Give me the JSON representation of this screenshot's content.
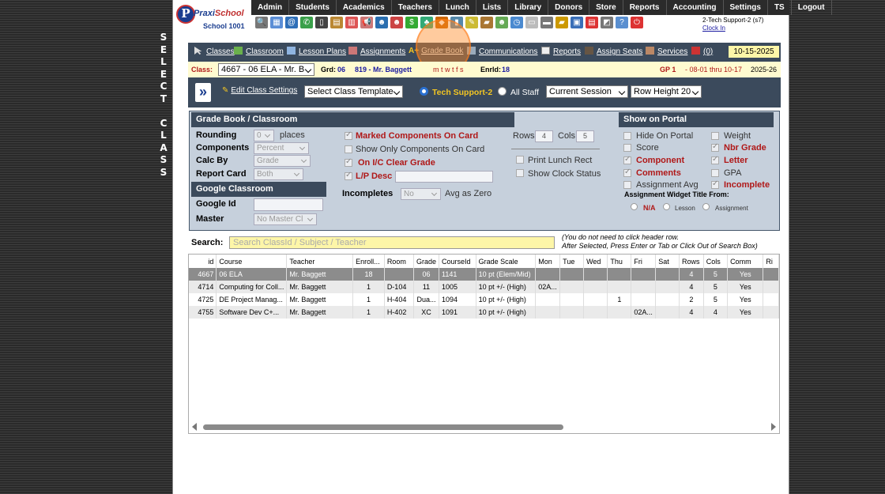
{
  "side_letters": [
    "S",
    "E",
    "L",
    "E",
    "C",
    "T",
    "",
    "C",
    "L",
    "A",
    "S",
    "S"
  ],
  "logo": {
    "letter": "P",
    "brand_a": "Praxi",
    "brand_b": "School",
    "school": "School 1001"
  },
  "menu": [
    "Admin",
    "Students",
    "Academics",
    "Teachers",
    "Lunch",
    "Lists",
    "Library",
    "Donors",
    "Store",
    "Reports",
    "Accounting",
    "Settings",
    "TS",
    "Logout"
  ],
  "toolbar_icons": [
    "search-icon",
    "grid-icon",
    "at-icon",
    "chat-icon",
    "phone-icon",
    "card-icon",
    "calendar-icon",
    "megaphone-icon",
    "person-icon",
    "person-icon",
    "money-icon",
    "group-icon",
    "lunch-icon",
    "book-icon",
    "pencil-icon",
    "cart-icon",
    "person-icon",
    "clock-icon",
    "card-icon",
    "id-icon",
    "bus-icon",
    "gradebook-icon",
    "pdf-icon",
    "chart-icon",
    "help-icon",
    "power-icon"
  ],
  "user": {
    "name": "2-Tech Support-2 (s7)",
    "clock_in": "Clock In"
  },
  "nav": {
    "classes": "Classes",
    "classroom": "Classroom",
    "lesson_plans": "Lesson Plans",
    "assignments": "Assignments",
    "grade_book": "Grade Book",
    "communications": "Communications",
    "reports": "Reports",
    "assign_seats": "Assign Seats",
    "services": "Services",
    "count": "(0)",
    "date": "10-15-2025"
  },
  "classbar": {
    "class_label": "Class:",
    "class_value": "4667 - 06 ELA - Mr. B",
    "grd_label": "Grd:",
    "grd": "06",
    "teacher": "819 - Mr. Baggett",
    "days": "m t w t f s",
    "enrld_label": "Enrld:",
    "enrld": "18",
    "gp": "GP 1",
    "gp_dates": "- 08-01 thru 10-17",
    "year": "2025-26"
  },
  "tools": {
    "edit_settings": "Edit Class Settings",
    "template": "Select Class Template",
    "staff_self": "Tech Support-2",
    "staff_all": "All Staff",
    "session": "Current Session",
    "row_height": "Row Height 20"
  },
  "settings": {
    "head": "Grade Book / Classroom",
    "rounding_label": "Rounding",
    "rounding": "0",
    "places": "places",
    "components_label": "Components",
    "components": "Percent",
    "calc_label": "Calc By",
    "calc": "Grade",
    "report_label": "Report Card",
    "report": "Both",
    "google_head": "Google Classroom",
    "google_id": "Google Id",
    "master": "Master",
    "master_value": "No Master Cl",
    "marked": "Marked Components On Card",
    "only": "Show Only Components On Card",
    "clear": "On I/C Clear Grade",
    "lp": "L/P Desc",
    "incompletes": "Incompletes",
    "incompletes_value": "No",
    "avg_zero": "Avg as Zero",
    "rows_label": "Rows",
    "rows": "4",
    "cols_label": "Cols",
    "cols": "5",
    "print_lunch": "Print Lunch Rect",
    "show_clock": "Show Clock Status",
    "portal_head": "Show on Portal",
    "hide": "Hide On Portal",
    "score": "Score",
    "component": "Component",
    "comments": "Comments",
    "assign_avg": "Assignment Avg",
    "weight": "Weight",
    "nbr": "Nbr Grade",
    "letter": "Letter",
    "gpa": "GPA",
    "incomplete": "Incomplete",
    "widget_title": "Assignment Widget Title From:",
    "na": "N/A",
    "lesson": "Lesson",
    "assignment": "Assignment"
  },
  "search": {
    "label": "Search:",
    "placeholder": "Search ClassId / Subject / Teacher",
    "note1": "(You do not need to click header row.",
    "note2": "After Selected, Press Enter or Tab or Click Out of Search Box)"
  },
  "table": {
    "headers": [
      "id",
      "Course",
      "Teacher",
      "Enroll...",
      "Room",
      "Grade",
      "CourseId",
      "Grade Scale",
      "Mon",
      "Tue",
      "Wed",
      "Thu",
      "Fri",
      "Sat",
      "Rows",
      "Cols",
      "Comm",
      "Ri"
    ],
    "rows": [
      [
        "4667",
        "06 ELA",
        "Mr. Baggett",
        "18",
        "",
        "06",
        "1141",
        "10 pt (Elem/Mid)",
        "",
        "",
        "",
        "",
        "",
        "",
        "4",
        "5",
        "Yes",
        ""
      ],
      [
        "4714",
        "Computing for Coll...",
        "Mr. Baggett",
        "1",
        "D-104",
        "11",
        "1005",
        "10 pt +/- (High)",
        "02A...",
        "",
        "",
        "",
        "",
        "",
        "4",
        "5",
        "Yes",
        ""
      ],
      [
        "4725",
        "DE Project Manag...",
        "Mr. Baggett",
        "1",
        "H-404",
        "Dua...",
        "1094",
        "10 pt +/- (High)",
        "",
        "",
        "",
        "1",
        "",
        "",
        "2",
        "5",
        "Yes",
        ""
      ],
      [
        "4755",
        "Software Dev C+...",
        "Mr. Baggett",
        "1",
        "H-402",
        "XC",
        "1091",
        "10 pt +/- (High)",
        "",
        "",
        "",
        "",
        "02A...",
        "",
        "4",
        "4",
        "Yes",
        ""
      ]
    ]
  },
  "colors": {
    "accent": "#3b4a5c",
    "highlight": "#fdf6a8",
    "red": "#b01818"
  }
}
